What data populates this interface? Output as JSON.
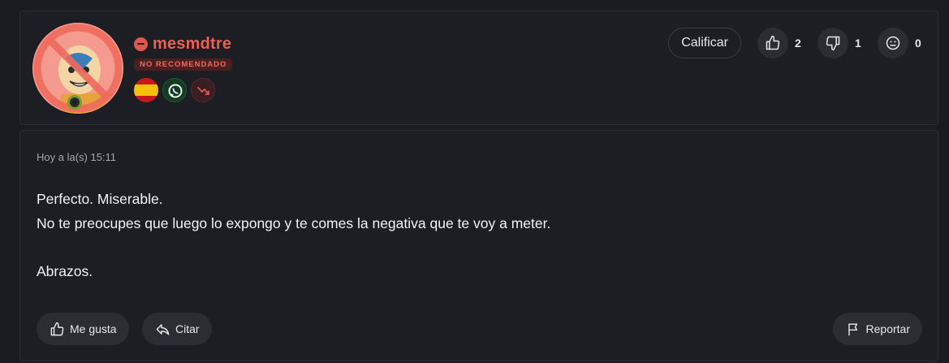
{
  "user": {
    "name": "mesmdtre",
    "status_badge": "NO RECOMENDADO"
  },
  "badges": [
    {
      "icon": "spain-flag-icon"
    },
    {
      "icon": "whatsapp-icon"
    },
    {
      "icon": "trend-down-icon"
    }
  ],
  "rating": {
    "rate_label": "Calificar",
    "likes": "2",
    "dislikes": "1",
    "neutral": "0"
  },
  "post": {
    "timestamp": "Hoy a la(s) 15:11",
    "line1": "Perfecto. Miserable.",
    "line2": "No te preocupes que luego lo expongo y te comes la negativa que te voy a meter.",
    "line3": "Abrazos."
  },
  "actions": {
    "like_label": "Me gusta",
    "quote_label": "Citar",
    "report_label": "Reportar"
  },
  "colors": {
    "accent_red": "#ee5e52",
    "background": "#1a1b20",
    "card": "#1d1e23"
  }
}
